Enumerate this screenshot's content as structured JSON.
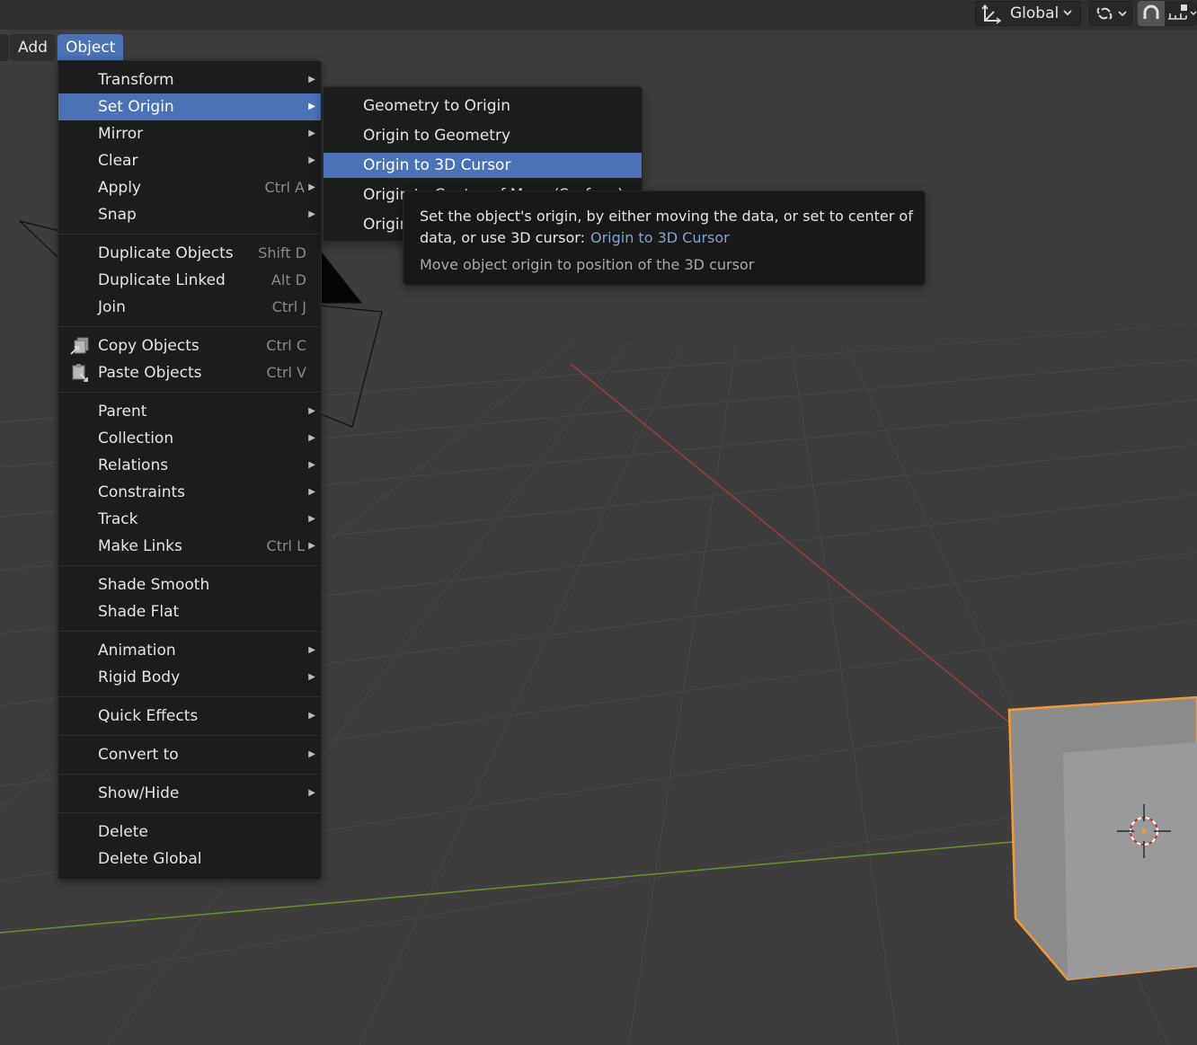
{
  "header": {
    "orientation_label": "Global",
    "orientation_icon": "transform-orientation-icon",
    "pivot_icon": "link-icon",
    "snap_icon": "magnet-icon",
    "snap_options_icon": "snap-increment-icon"
  },
  "menubar": {
    "add_label": "Add",
    "object_label": "Object"
  },
  "object_menu": {
    "items": [
      {
        "label": "Transform",
        "has_submenu": true
      },
      {
        "label": "Set Origin",
        "has_submenu": true,
        "highlighted": true
      },
      {
        "label": "Mirror",
        "has_submenu": true
      },
      {
        "label": "Clear",
        "has_submenu": true
      },
      {
        "label": "Apply",
        "shortcut": "Ctrl A",
        "has_submenu": true
      },
      {
        "label": "Snap",
        "has_submenu": true
      },
      {
        "label": "Duplicate Objects",
        "shortcut": "Shift D"
      },
      {
        "label": "Duplicate Linked",
        "shortcut": "Alt D"
      },
      {
        "label": "Join",
        "shortcut": "Ctrl J"
      },
      {
        "label": "Copy Objects",
        "shortcut": "Ctrl C",
        "icon": "copy-icon"
      },
      {
        "label": "Paste Objects",
        "shortcut": "Ctrl V",
        "icon": "paste-icon"
      },
      {
        "label": "Parent",
        "has_submenu": true
      },
      {
        "label": "Collection",
        "has_submenu": true
      },
      {
        "label": "Relations",
        "has_submenu": true
      },
      {
        "label": "Constraints",
        "has_submenu": true
      },
      {
        "label": "Track",
        "has_submenu": true
      },
      {
        "label": "Make Links",
        "shortcut": "Ctrl L",
        "has_submenu": true
      },
      {
        "label": "Shade Smooth"
      },
      {
        "label": "Shade Flat"
      },
      {
        "label": "Animation",
        "has_submenu": true
      },
      {
        "label": "Rigid Body",
        "has_submenu": true
      },
      {
        "label": "Quick Effects",
        "has_submenu": true
      },
      {
        "label": "Convert to",
        "has_submenu": true
      },
      {
        "label": "Show/Hide",
        "has_submenu": true
      },
      {
        "label": "Delete"
      },
      {
        "label": "Delete Global"
      }
    ]
  },
  "set_origin_submenu": {
    "items": [
      {
        "label": "Geometry to Origin"
      },
      {
        "label": "Origin to Geometry"
      },
      {
        "label": "Origin to 3D Cursor",
        "highlighted": true
      },
      {
        "label": "Origin to Center of Mass (Surface)"
      },
      {
        "label": "Origin"
      }
    ]
  },
  "tooltip": {
    "description": "Set the object's origin, by either moving the data, or set to center of data, or use 3D cursor:",
    "operator": "Origin to 3D Cursor",
    "detail": "Move object origin to position of the 3D cursor"
  },
  "colors": {
    "viewport_bg": "#3d3d3d",
    "menu_bg": "#1c1c1c",
    "highlight": "#4a72b5",
    "selection_outline": "#f29a38",
    "x_axis": "#a33b3b",
    "y_axis": "#6c8f2c"
  }
}
